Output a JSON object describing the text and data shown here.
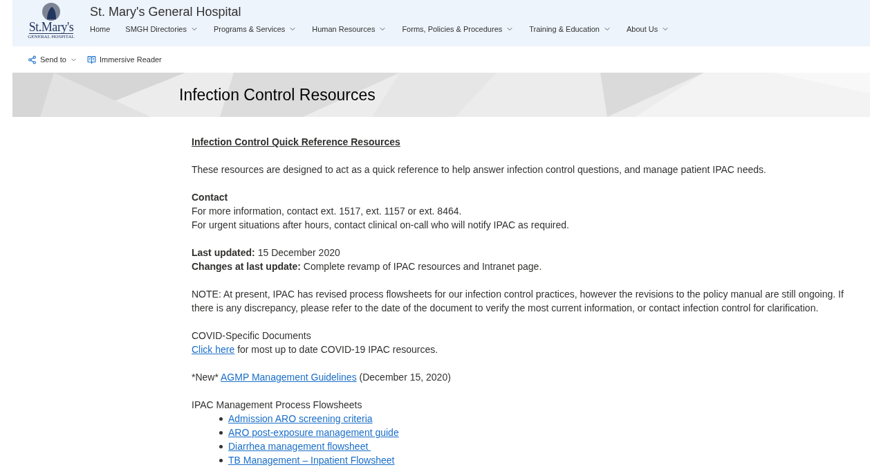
{
  "site": {
    "logo_text": "St.Mary's",
    "logo_subtext": "GENERAL HOSPITAL",
    "title": "St. Mary's General Hospital"
  },
  "nav": [
    {
      "label": "Home",
      "dropdown": false
    },
    {
      "label": "SMGH Directories",
      "dropdown": true
    },
    {
      "label": "Programs & Services",
      "dropdown": true
    },
    {
      "label": "Human Resources",
      "dropdown": true
    },
    {
      "label": "Forms, Policies & Procedures",
      "dropdown": true
    },
    {
      "label": "Training & Education",
      "dropdown": true
    },
    {
      "label": "About Us",
      "dropdown": true
    }
  ],
  "toolbar": [
    {
      "kind": "share",
      "label": "Send to",
      "dropdown": true
    },
    {
      "kind": "reader",
      "label": "Immersive Reader",
      "dropdown": false
    }
  ],
  "banner": {
    "title": "Infection Control Resources"
  },
  "content": {
    "heading": "Infection Control Quick Reference Resources",
    "blocks": [
      {
        "lines": [
          [
            {
              "kind": "text",
              "text": "These resources are designed to act as a quick reference to help answer infection control questions, and manage patient IPAC needs."
            }
          ]
        ]
      },
      {
        "lines": [
          [
            {
              "kind": "bold",
              "text": "Contact"
            }
          ],
          [
            {
              "kind": "text",
              "text": "For more information, contact ext. 1517, ext. 1157 or ext. 8464."
            }
          ],
          [
            {
              "kind": "text",
              "text": "For urgent situations after hours, contact clinical on-call who will notify IPAC as required."
            }
          ]
        ]
      },
      {
        "lines": [
          [
            {
              "kind": "text",
              "text": "**Last updated:** 15 December 2020"
            }
          ],
          [
            {
              "kind": "text",
              "text": "**Changes at last update:** Complete revamp of IPAC resources and Intranet page."
            }
          ]
        ]
      },
      {
        "lines": [
          [
            {
              "kind": "text",
              "text": "NOTE: At present, IPAC has revised process flowsheets for our infection control practices, however the revisions to the policy manual are still ongoing. If there is any discrepancy, please refer to the date of the document to verify the most current information, or contact infection control for clarification."
            }
          ]
        ]
      },
      {
        "lines": [
          [
            {
              "kind": "text",
              "text": "COVID-Specific Documents"
            }
          ],
          [
            {
              "kind": "link",
              "text": "Click here"
            },
            {
              "kind": "text",
              "text": " for most up to date COVID-19 IPAC resources."
            }
          ]
        ]
      },
      {
        "lines": [
          [
            {
              "kind": "plain",
              "text": "*New* "
            },
            {
              "kind": "link",
              "text": "AGMP Management Guidelines"
            },
            {
              "kind": "text",
              "text": " (December 15, 2020)"
            }
          ]
        ]
      },
      {
        "lines": [
          [
            {
              "kind": "text",
              "text": "IPAC Management Process Flowsheets"
            }
          ]
        ],
        "bullets": [
          "Admission ARO screening criteria",
          "ARO post-exposure management guide",
          "Diarrhea management flowsheet ",
          "TB Management – Inpatient Flowsheet"
        ]
      }
    ]
  }
}
